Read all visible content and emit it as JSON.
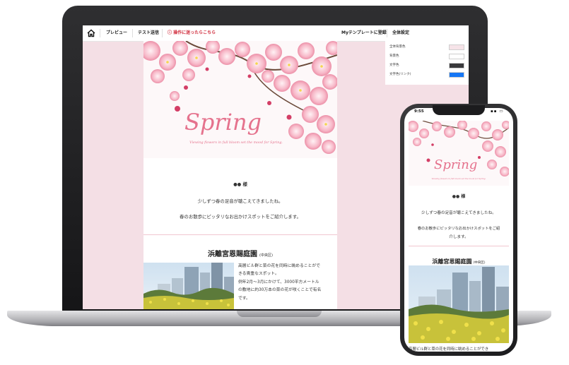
{
  "toolbar": {
    "preview_label": "プレビュー",
    "test_send_label": "テスト送信",
    "help_label": "ⓘ 操作に迷ったらこちら",
    "save_template_label": "Myテンプレートに登録",
    "global_settings_label": "全体設定"
  },
  "settings_panel": {
    "rows": [
      {
        "label": "全体背景色",
        "color": "#f6e3e8"
      },
      {
        "label": "背景色",
        "color": "#ffffff"
      },
      {
        "label": "文字色",
        "color": "#3a3a3c"
      },
      {
        "label": "文字色(リンク)",
        "color": "#1677f5"
      }
    ]
  },
  "email": {
    "hero_title": "Spring",
    "hero_subtitle": "Viewing flowers in full bloom set the mood for Spring.",
    "greeting": "●● 様",
    "intro_line1": "少しずつ春の足音が聴こえてきましたね。",
    "intro_line2": "春のお散歩にピッタリなお出かけスポットをご紹介します。",
    "section_title": "浜離宮恩賜庭園",
    "section_area": "(中央区)",
    "body_lines": [
      "高層ビル群と菜の花を同時に眺めることがで",
      "きる貴重なスポット。",
      "例年2月〜3月にかけて、3000平方メートル",
      "の敷地に約30万本の菜の花が咲くことで有名",
      "です。"
    ]
  },
  "phone": {
    "time": "9:55",
    "intro_line2a": "春のお散歩にピッタリなお出かけスポットをご紹",
    "intro_line2b": "介します。",
    "bottom_text": "高層ビル群と菜の花を同時に眺めることができ"
  },
  "colors": {
    "accent_pink": "#e5728d",
    "background_pink": "#f6e3e8",
    "help_red": "#d02c3c"
  }
}
